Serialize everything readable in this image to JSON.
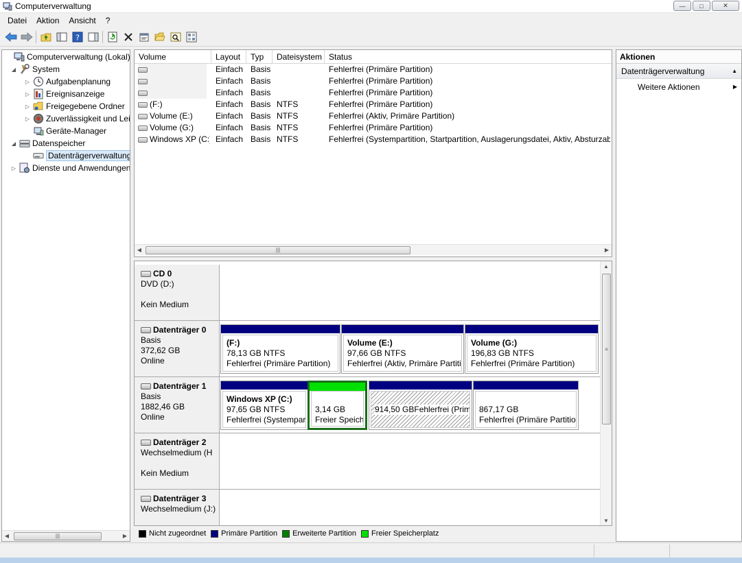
{
  "window": {
    "title": "Computerverwaltung",
    "controls": {
      "minimize": "—",
      "maximize": "□",
      "close": "✕"
    }
  },
  "menu": [
    "Datei",
    "Aktion",
    "Ansicht",
    "?"
  ],
  "toolbar_icons": [
    "back-arrow-icon",
    "forward-arrow-icon",
    "up-folder-icon",
    "show-hide-tree-icon",
    "help-icon",
    "show-hide-actions-icon",
    "refresh-icon",
    "delete-icon",
    "properties-icon",
    "open-icon",
    "search-icon",
    "settings-icon"
  ],
  "tree": {
    "items": [
      {
        "label": "Computerverwaltung (Lokal)",
        "icon": "computer-icon",
        "level": 0,
        "expander": ""
      },
      {
        "label": "System",
        "icon": "tools-icon",
        "level": 1,
        "expander": "◢"
      },
      {
        "label": "Aufgabenplanung",
        "icon": "clock-icon",
        "level": 2,
        "expander": "▷"
      },
      {
        "label": "Ereignisanzeige",
        "icon": "event-log-icon",
        "level": 2,
        "expander": "▷"
      },
      {
        "label": "Freigegebene Ordner",
        "icon": "shared-folder-icon",
        "level": 2,
        "expander": "▷"
      },
      {
        "label": "Zuverlässigkeit und Leis",
        "icon": "performance-icon",
        "level": 2,
        "expander": "▷"
      },
      {
        "label": "Geräte-Manager",
        "icon": "device-manager-icon",
        "level": 2,
        "expander": ""
      },
      {
        "label": "Datenspeicher",
        "icon": "storage-icon",
        "level": 1,
        "expander": "◢"
      },
      {
        "label": "Datenträgerverwaltung",
        "icon": "disk-management-icon",
        "level": 2,
        "expander": "",
        "selected": true
      },
      {
        "label": "Dienste und Anwendungen",
        "icon": "services-icon",
        "level": 1,
        "expander": "▷"
      }
    ],
    "scroll_arrows": {
      "left": "◀",
      "right": "▶",
      "grip": "|||"
    }
  },
  "volumes": {
    "columns": [
      "Volume",
      "Layout",
      "Typ",
      "Dateisystem",
      "Status"
    ],
    "rows": [
      [
        "",
        "Einfach",
        "Basis",
        "",
        "Fehlerfrei (Primäre Partition)"
      ],
      [
        "",
        "Einfach",
        "Basis",
        "",
        "Fehlerfrei (Primäre Partition)"
      ],
      [
        "",
        "Einfach",
        "Basis",
        "",
        "Fehlerfrei (Primäre Partition)"
      ],
      [
        "(F:)",
        "Einfach",
        "Basis",
        "NTFS",
        "Fehlerfrei (Primäre Partition)"
      ],
      [
        "Volume (E:)",
        "Einfach",
        "Basis",
        "NTFS",
        "Fehlerfrei (Aktiv, Primäre Partition)"
      ],
      [
        "Volume (G:)",
        "Einfach",
        "Basis",
        "NTFS",
        "Fehlerfrei (Primäre Partition)"
      ],
      [
        "Windows XP (C:)",
        "Einfach",
        "Basis",
        "NTFS",
        "Fehlerfrei (Systempartition, Startpartition, Auslagerungsdatei, Aktiv, Absturzabbild, Primäre Partition)"
      ]
    ],
    "scroll_arrows": {
      "left": "◀",
      "right": "▶",
      "grip": "|||"
    }
  },
  "disks": [
    {
      "name": "CD 0",
      "lines": [
        "DVD (D:)",
        "",
        "Kein Medium"
      ],
      "icon": "cd-drive-icon",
      "partitions": []
    },
    {
      "name": "Datenträger 0",
      "lines": [
        "Basis",
        "372,62 GB",
        "Online"
      ],
      "icon": "hard-disk-icon",
      "partitions": [
        {
          "name": "(F:)",
          "size": "78,13 GB NTFS",
          "status": "Fehlerfrei (Primäre Partition)",
          "kind": "primary"
        },
        {
          "name": "Volume  (E:)",
          "size": "97,66 GB NTFS",
          "status": "Fehlerfrei (Aktiv, Primäre Partiti",
          "kind": "primary"
        },
        {
          "name": "Volume  (G:)",
          "size": "196,83 GB NTFS",
          "status": "Fehlerfrei (Primäre Partition)",
          "kind": "primary"
        }
      ]
    },
    {
      "name": "Datenträger 1",
      "lines": [
        "Basis",
        "1882,46 GB",
        "Online"
      ],
      "icon": "hard-disk-icon",
      "partitions": [
        {
          "name": "Windows XP  (C:)",
          "size": "97,65 GB NTFS",
          "status": "Fehlerfrei (Systempar",
          "kind": "primary"
        },
        {
          "name": "",
          "size": "3,14 GB",
          "status": "Freier Speich",
          "kind": "free"
        },
        {
          "name": "",
          "size": "914,50 GB",
          "status": "Fehlerfrei (Primäre Partitic",
          "kind": "primary-hatched"
        },
        {
          "name": "",
          "size": "867,17 GB",
          "status": "Fehlerfrei (Primäre Partitio",
          "kind": "primary"
        }
      ]
    },
    {
      "name": "Datenträger 2",
      "lines": [
        "Wechselmedium (H",
        "",
        "Kein Medium"
      ],
      "icon": "removable-disk-icon",
      "partitions": []
    },
    {
      "name": "Datenträger 3",
      "lines": [
        "Wechselmedium (J:)"
      ],
      "icon": "removable-disk-icon",
      "partitions": []
    }
  ],
  "disk_scroll": {
    "up": "▲",
    "down": "▼",
    "grip": "≡"
  },
  "legend": [
    {
      "label": "Nicht zugeordnet",
      "color": "#000000"
    },
    {
      "label": "Primäre Partition",
      "color": "#000080"
    },
    {
      "label": "Erweiterte Partition",
      "color": "#008000"
    },
    {
      "label": "Freier Speicherplatz",
      "color": "#00e000"
    }
  ],
  "actions": {
    "header": "Aktionen",
    "section": "Datenträgerverwaltung",
    "section_arrow": "▲",
    "item": "Weitere Aktionen",
    "item_arrow": "▶"
  },
  "colors": {
    "primary_bar": "#000080",
    "free_bar": "#00e000",
    "selected_border": "#1a6d1a"
  }
}
